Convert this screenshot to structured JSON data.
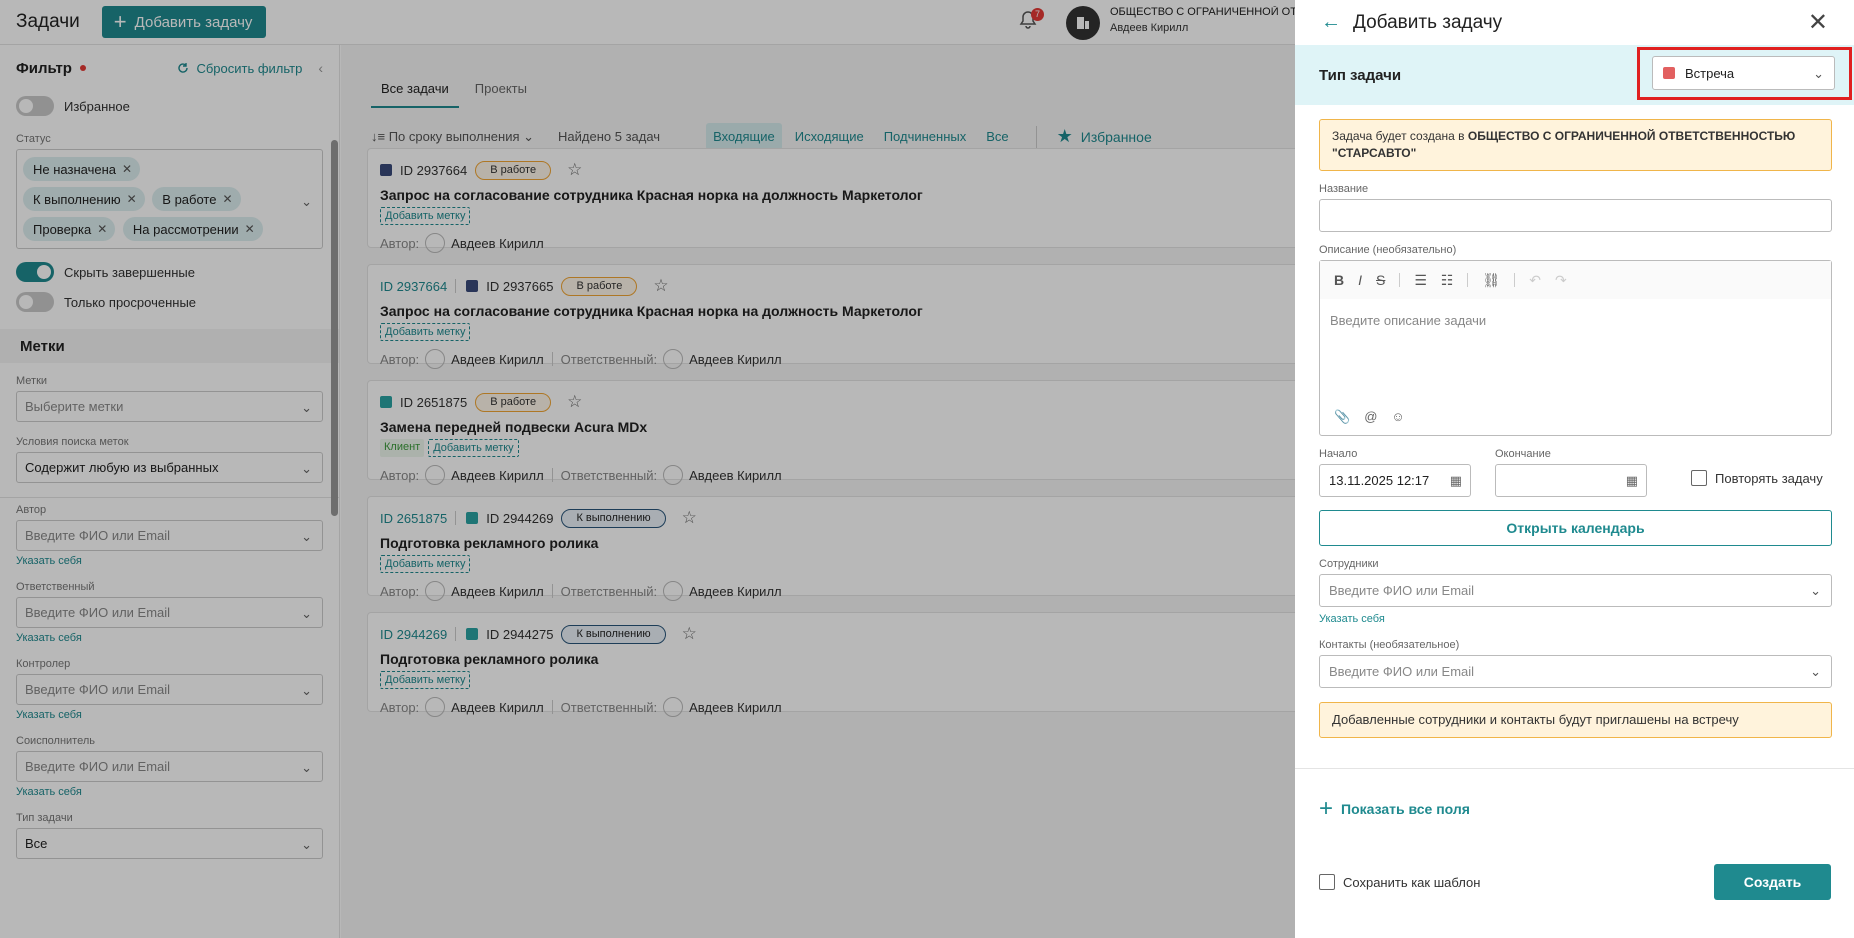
{
  "topbar": {
    "title": "Задачи",
    "add_label": "Добавить задачу",
    "notifications": "7",
    "org_name": "ОБЩЕСТВО С ОГРАНИЧЕННОЙ ОТВЕТСТВЕННОСТЬЮ",
    "user": "Авдеев Кирилл"
  },
  "sidebar": {
    "filter_label": "Фильтр",
    "reset_label": "Сбросить фильтр",
    "favorites_label": "Избранное",
    "status_label": "Статус",
    "chips": [
      "Не назначена",
      "К выполнению",
      "В работе",
      "Проверка",
      "На рассмотрении"
    ],
    "hide_done_label": "Скрыть завершенные",
    "overdue_label": "Только просроченные",
    "tags_section": "Метки",
    "tags_label": "Метки",
    "tags_placeholder": "Выберите метки",
    "tags_condition_label": "Условия поиска меток",
    "tags_condition_value": "Содержит любую из выбранных",
    "author_label": "Автор",
    "responsible_label": "Ответственный",
    "controller_label": "Контролер",
    "coexecutor_label": "Соисполнитель",
    "task_type_label": "Тип задачи",
    "task_type_value": "Все",
    "person_placeholder": "Введите ФИО или Email",
    "self_link": "Указать себя"
  },
  "main": {
    "tabs": [
      "Все задачи",
      "Проекты"
    ],
    "sort_label": "По сроку выполнения",
    "found_label": "Найдено 5 задач",
    "filters": [
      "Входящие",
      "Исходящие",
      "Подчиненных",
      "Все"
    ],
    "favorites": "Избранное",
    "author_prefix": "Автор:",
    "responsible_prefix": "Ответственный:",
    "add_tag": "Добавить метку",
    "tasks": [
      {
        "parent": "",
        "id": "ID 2937664",
        "status": "В работе",
        "name": "Запрос на согласование сотрудника Красная норка на должность Маркетолог",
        "client": "",
        "author": "Авдеев Кирилл",
        "responsible": ""
      },
      {
        "parent": "ID 2937664",
        "id": "ID 2937665",
        "status": "В работе",
        "name": "Запрос на согласование сотрудника Красная норка на должность Маркетолог",
        "client": "",
        "author": "Авдеев Кирилл",
        "responsible": "Авдеев Кирилл"
      },
      {
        "parent": "",
        "id": "ID 2651875",
        "status": "В работе",
        "name": "Замена передней подвески Acura MDx",
        "client": "Клиент",
        "author": "Авдеев Кирилл",
        "responsible": "Авдеев Кирилл"
      },
      {
        "parent": "ID 2651875",
        "id": "ID 2944269",
        "status": "К выполнению",
        "name": "Подготовка рекламного ролика",
        "client": "",
        "author": "Авдеев Кирилл",
        "responsible": "Авдеев Кирилл"
      },
      {
        "parent": "ID 2944269",
        "id": "ID 2944275",
        "status": "К выполнению",
        "name": "Подготовка рекламного ролика",
        "client": "",
        "author": "Авдеев Кирилл",
        "responsible": "Авдеев Кирилл"
      }
    ]
  },
  "panel": {
    "title": "Добавить задачу",
    "type_label": "Тип задачи",
    "type_value": "Встреча",
    "notice_prefix": "Задача будет создана в",
    "notice_org": "ОБЩЕСТВО С ОГРАНИЧЕННОЙ ОТВЕТСТВЕННОСТЬЮ \"СТАРСАВТО\"",
    "name_label": "Название",
    "desc_label": "Описание (необязательно)",
    "desc_placeholder": "Введите описание задачи",
    "start_label": "Начало",
    "start_value": "13.11.2025 12:17",
    "end_label": "Окончание",
    "repeat_label": "Повторять задачу",
    "open_calendar": "Открыть календарь",
    "employees_label": "Сотрудники",
    "employees_placeholder": "Введите ФИО или Email",
    "self_link": "Указать себя",
    "contacts_label": "Контакты (необязательное)",
    "contacts_placeholder": "Введите ФИО или Email",
    "invite_notice": "Добавленные сотрудники и контакты будут приглашены на встречу",
    "show_all": "Показать все поля",
    "save_template": "Сохранить как шаблон",
    "create": "Создать"
  },
  "colors": {
    "accent": "#1f8a8f",
    "highlight": "#e02020",
    "warning_bg": "#fff3dc"
  }
}
